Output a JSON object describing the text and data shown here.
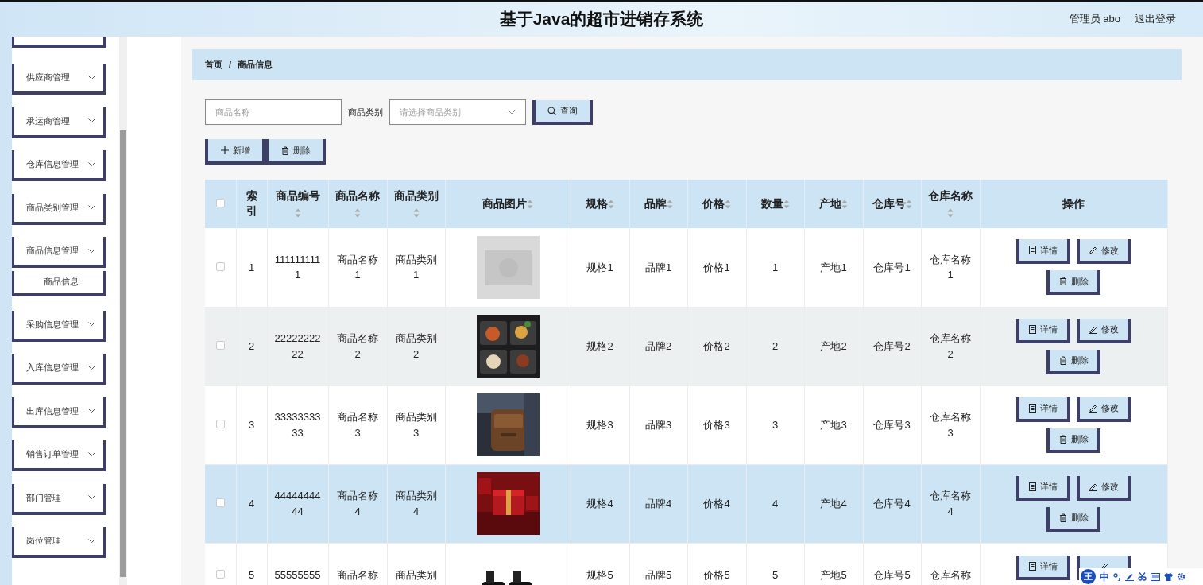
{
  "header": {
    "title": "基于Java的超市进销存系统",
    "user": "管理员 abo",
    "logout": "退出登录"
  },
  "sidebar": {
    "items": [
      {
        "kind": "clipped"
      },
      {
        "kind": "menu",
        "label": "供应商管理"
      },
      {
        "kind": "menu",
        "label": "承运商管理"
      },
      {
        "kind": "menu",
        "label": "仓库信息管理"
      },
      {
        "kind": "menu",
        "label": "商品类别管理"
      },
      {
        "kind": "menu",
        "label": "商品信息管理",
        "expanded": true,
        "children": [
          {
            "label": "商品信息"
          }
        ]
      },
      {
        "kind": "menu",
        "label": "采购信息管理"
      },
      {
        "kind": "menu",
        "label": "入库信息管理"
      },
      {
        "kind": "menu",
        "label": "出库信息管理"
      },
      {
        "kind": "menu",
        "label": "销售订单管理"
      },
      {
        "kind": "menu",
        "label": "部门管理"
      },
      {
        "kind": "menu",
        "label": "岗位管理"
      }
    ]
  },
  "breadcrumb": {
    "items": [
      "首页",
      "商品信息"
    ],
    "separator": "/"
  },
  "search": {
    "name_placeholder": "商品名称",
    "category_label": "商品类别",
    "category_placeholder": "请选择商品类别",
    "button": "查询"
  },
  "toolbar": [
    {
      "kind": "add",
      "label": "新增"
    },
    {
      "kind": "delete",
      "label": "删除"
    }
  ],
  "table": {
    "select_all_checked": false,
    "columns": [
      {
        "label": "索引",
        "sortable": false
      },
      {
        "label": "商品编号",
        "sortable": true
      },
      {
        "label": "商品名称",
        "sortable": true
      },
      {
        "label": "商品类别",
        "sortable": true
      },
      {
        "label": "商品图片",
        "sortable": true
      },
      {
        "label": "规格",
        "sortable": true
      },
      {
        "label": "品牌",
        "sortable": true
      },
      {
        "label": "价格",
        "sortable": true
      },
      {
        "label": "数量",
        "sortable": true
      },
      {
        "label": "产地",
        "sortable": true
      },
      {
        "label": "仓库号",
        "sortable": true
      },
      {
        "label": "仓库名称",
        "sortable": true
      },
      {
        "label": "操作",
        "sortable": false
      }
    ],
    "rows": [
      {
        "checked": false,
        "hovered": false,
        "selected": false,
        "clipped": false,
        "cells": [
          "1",
          "1111111111",
          "商品名称1",
          "商品类别1",
          {
            "kind": "picture"
          },
          "规格1",
          "品牌1",
          "价格1",
          "1",
          "产地1",
          "仓库号1",
          "仓库名称1"
        ],
        "actions": [
          {
            "kind": "detail",
            "label": "详情"
          },
          {
            "kind": "edit",
            "label": "修改"
          },
          {
            "kind": "delete",
            "label": "删除"
          }
        ]
      },
      {
        "checked": false,
        "hovered": true,
        "selected": false,
        "clipped": false,
        "cells": [
          "2",
          "2222222222",
          "商品名称2",
          "商品类别2",
          {
            "kind": "picture"
          },
          "规格2",
          "品牌2",
          "价格2",
          "2",
          "产地2",
          "仓库号2",
          "仓库名称2"
        ],
        "actions": [
          {
            "kind": "detail",
            "label": "详情"
          },
          {
            "kind": "edit",
            "label": "修改"
          },
          {
            "kind": "delete",
            "label": "删除"
          }
        ]
      },
      {
        "checked": false,
        "hovered": false,
        "selected": false,
        "clipped": false,
        "cells": [
          "3",
          "3333333333",
          "商品名称3",
          "商品类别3",
          {
            "kind": "picture"
          },
          "规格3",
          "品牌3",
          "价格3",
          "3",
          "产地3",
          "仓库号3",
          "仓库名称3"
        ],
        "actions": [
          {
            "kind": "detail",
            "label": "详情"
          },
          {
            "kind": "edit",
            "label": "修改"
          },
          {
            "kind": "delete",
            "label": "删除"
          }
        ]
      },
      {
        "checked": false,
        "hovered": false,
        "selected": true,
        "clipped": false,
        "cells": [
          "4",
          "4444444444",
          "商品名称4",
          "商品类别4",
          {
            "kind": "picture"
          },
          "规格4",
          "品牌4",
          "价格4",
          "4",
          "产地4",
          "仓库号4",
          "仓库名称4"
        ],
        "actions": [
          {
            "kind": "detail",
            "label": "详情"
          },
          {
            "kind": "edit",
            "label": "修改"
          },
          {
            "kind": "delete",
            "label": "删除"
          }
        ]
      },
      {
        "checked": false,
        "hovered": false,
        "selected": false,
        "clipped": true,
        "cells": [
          "5",
          "55555555",
          "商品名称",
          "商品类别",
          {
            "kind": "picture"
          },
          "规格5",
          "品牌5",
          "价格5",
          "5",
          "产地5",
          "仓库号5",
          "仓库名称"
        ],
        "actions": [
          {
            "kind": "detail",
            "label": "详情"
          },
          {
            "kind": "edit"
          }
        ]
      }
    ]
  },
  "ime_toolbar": {
    "logo": "王",
    "mode": "中"
  }
}
